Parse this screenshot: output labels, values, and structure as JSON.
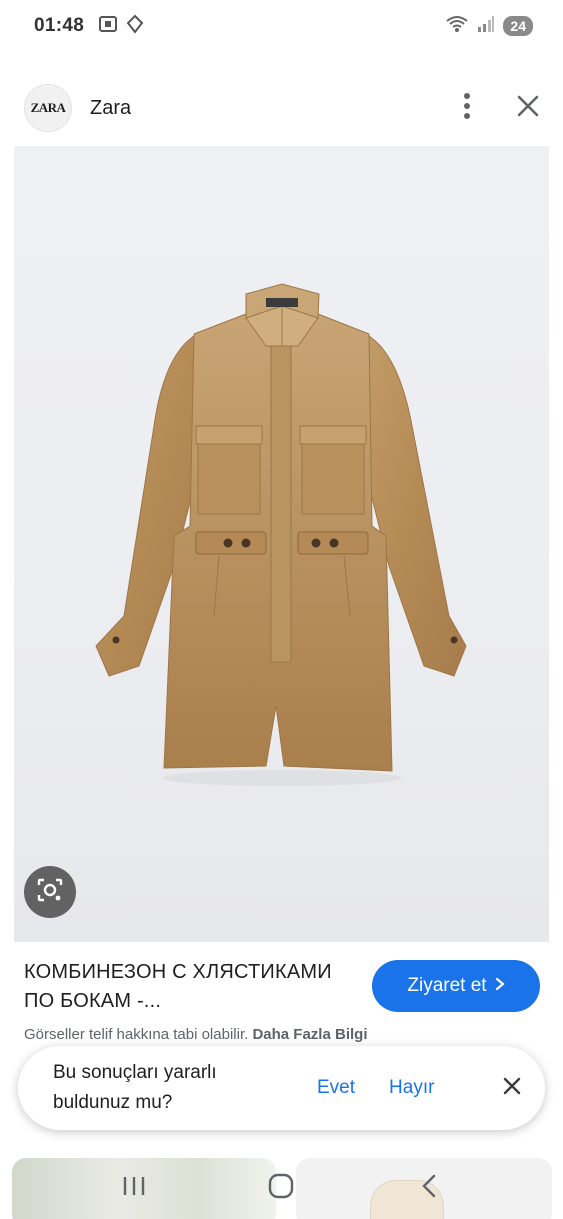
{
  "status_bar": {
    "time": "01:48",
    "battery": "24",
    "icons": [
      "screenshot-icon",
      "location-icon",
      "wifi-icon",
      "signal-icon"
    ]
  },
  "header": {
    "logo_text": "ZARA",
    "site_name": "Zara",
    "icons": [
      "more-vert-icon",
      "close-icon"
    ]
  },
  "image": {
    "subject": "tan utility playsuit with collar, chest pockets, belted waist",
    "lens_icon": "lens-icon"
  },
  "result": {
    "title": "КОМБИНЕЗОН С ХЛЯСТИКАМИ ПО БОКАМ -...",
    "visit_label": "Ziyaret et",
    "copyright_text": "Görseller telif hakkına tabi olabilir.",
    "more_info_label": "Daha Fazla Bilgi"
  },
  "feedback": {
    "question": "Bu sonuçları yararlı buldunuz mu?",
    "yes_label": "Evet",
    "no_label": "Hayır"
  },
  "nav": {
    "icons": [
      "recents-icon",
      "home-icon",
      "back-icon"
    ]
  },
  "colors": {
    "accent": "#1a73e8",
    "garment": "#b58e5a",
    "background_image": "#eceef1"
  }
}
